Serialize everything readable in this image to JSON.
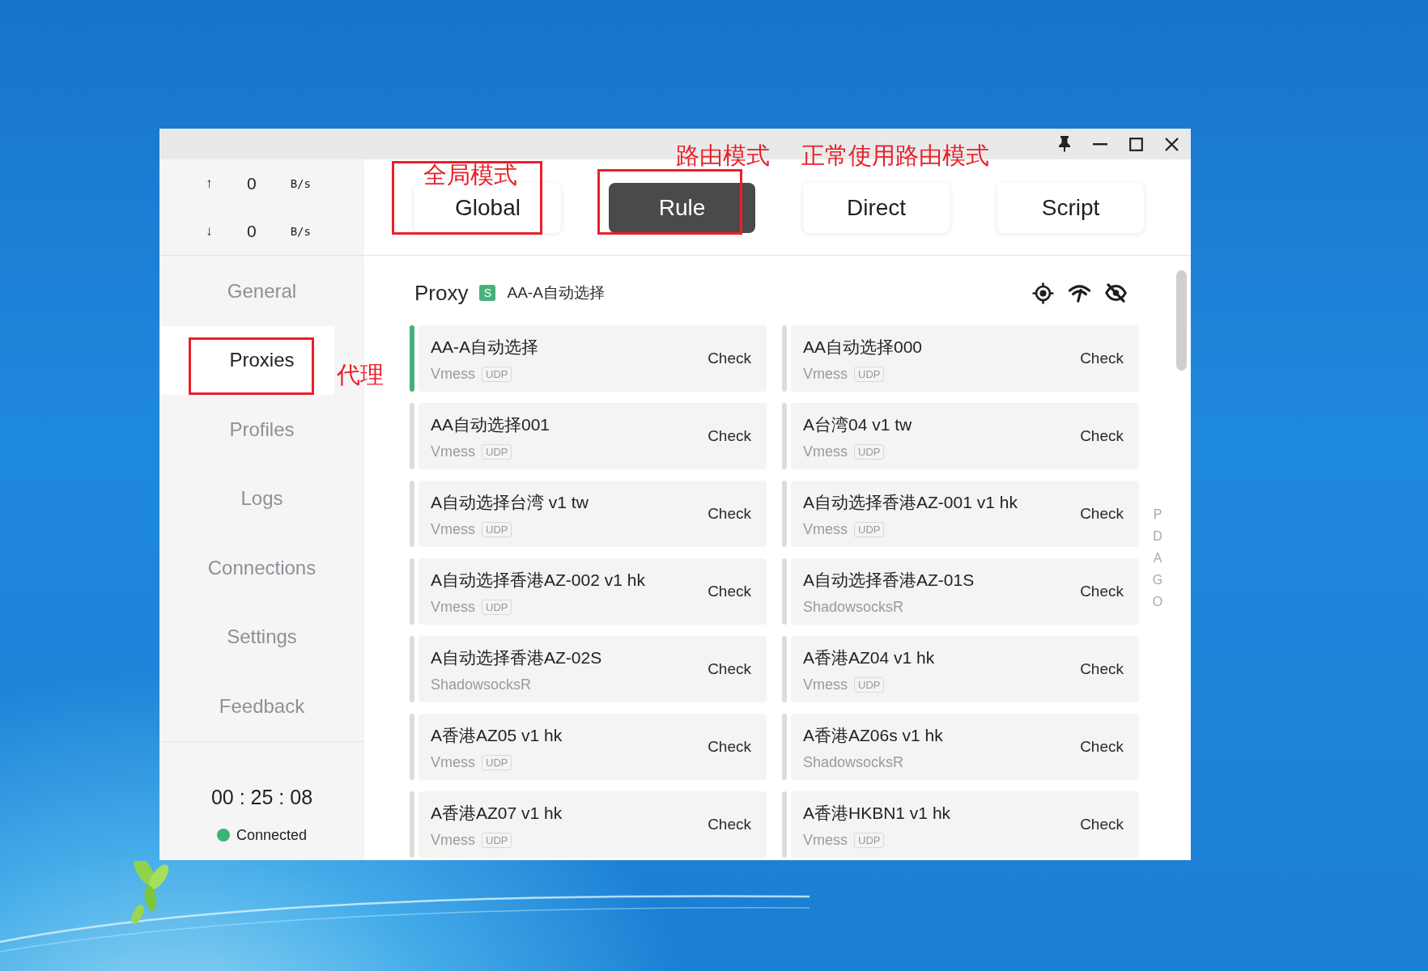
{
  "traffic": [
    {
      "arrow": "↑",
      "value": "0",
      "unit": "B/s"
    },
    {
      "arrow": "↓",
      "value": "0",
      "unit": "B/s"
    }
  ],
  "sidebar": {
    "items": [
      {
        "label": "General",
        "selected": false
      },
      {
        "label": "Proxies",
        "selected": true
      },
      {
        "label": "Profiles",
        "selected": false
      },
      {
        "label": "Logs",
        "selected": false
      },
      {
        "label": "Connections",
        "selected": false
      },
      {
        "label": "Settings",
        "selected": false
      },
      {
        "label": "Feedback",
        "selected": false
      }
    ]
  },
  "status": {
    "time": "00 : 25 : 08",
    "label": "Connected",
    "connected": true
  },
  "modes": [
    {
      "label": "Global",
      "selected": false
    },
    {
      "label": "Rule",
      "selected": true
    },
    {
      "label": "Direct",
      "selected": false
    },
    {
      "label": "Script",
      "selected": false
    }
  ],
  "proxy_group": {
    "title": "Proxy",
    "badge": "S",
    "current": "AA-A自动选择"
  },
  "proxies": [
    {
      "name": "AA-A自动选择",
      "type": "Vmess",
      "tag": "UDP",
      "action": "Check",
      "selected": true
    },
    {
      "name": "AA自动选择000",
      "type": "Vmess",
      "tag": "UDP",
      "action": "Check",
      "selected": false
    },
    {
      "name": "AA自动选择001",
      "type": "Vmess",
      "tag": "UDP",
      "action": "Check",
      "selected": false
    },
    {
      "name": "A台湾04 v1 tw",
      "type": "Vmess",
      "tag": "UDP",
      "action": "Check",
      "selected": false
    },
    {
      "name": "A自动选择台湾 v1 tw",
      "type": "Vmess",
      "tag": "UDP",
      "action": "Check",
      "selected": false
    },
    {
      "name": "A自动选择香港AZ-001 v1 hk",
      "type": "Vmess",
      "tag": "UDP",
      "action": "Check",
      "selected": false
    },
    {
      "name": "A自动选择香港AZ-002 v1 hk",
      "type": "Vmess",
      "tag": "UDP",
      "action": "Check",
      "selected": false
    },
    {
      "name": "A自动选择香港AZ-01S",
      "type": "ShadowsocksR",
      "action": "Check",
      "selected": false
    },
    {
      "name": "A自动选择香港AZ-02S",
      "type": "ShadowsocksR",
      "action": "Check",
      "selected": false
    },
    {
      "name": "A香港AZ04 v1 hk",
      "type": "Vmess",
      "tag": "UDP",
      "action": "Check",
      "selected": false
    },
    {
      "name": "A香港AZ05 v1 hk",
      "type": "Vmess",
      "tag": "UDP",
      "action": "Check",
      "selected": false
    },
    {
      "name": "A香港AZ06s v1 hk",
      "type": "ShadowsocksR",
      "action": "Check",
      "selected": false
    },
    {
      "name": "A香港AZ07 v1 hk",
      "type": "Vmess",
      "tag": "UDP",
      "action": "Check",
      "selected": false
    },
    {
      "name": "A香港HKBN1 v1 hk",
      "type": "Vmess",
      "tag": "UDP",
      "action": "Check",
      "selected": false
    }
  ],
  "index_letters": [
    "P",
    "D",
    "A",
    "G",
    "O"
  ],
  "annotations": [
    {
      "kind": "frame"
    },
    {
      "kind": "label",
      "text": "全局模式"
    },
    {
      "kind": "frame"
    },
    {
      "kind": "label",
      "text": "路由模式"
    },
    {
      "kind": "label",
      "text": "正常使用路由模式"
    },
    {
      "kind": "frame"
    },
    {
      "kind": "label",
      "text": "代理"
    }
  ]
}
